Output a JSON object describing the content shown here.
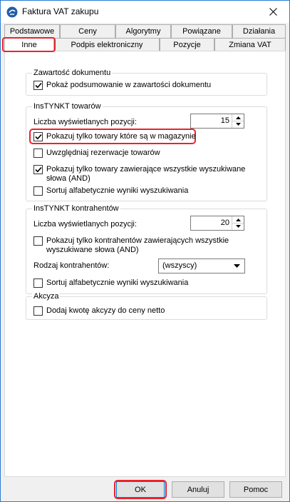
{
  "window": {
    "title": "Faktura VAT zakupu"
  },
  "tabs_row1": [
    "Podstawowe",
    "Ceny",
    "Algorytmy",
    "Powiązane",
    "Działania"
  ],
  "tabs_row2": [
    "Inne",
    "Podpis elektroniczny",
    "Pozycje",
    "Zmiana VAT"
  ],
  "active_tab": "Inne",
  "groups": {
    "zawartosc": {
      "title": "Zawartość dokumentu",
      "show_summary": {
        "label": "Pokaż podsumowanie w zawartości dokumentu",
        "checked": true
      }
    },
    "towary": {
      "title": "InsTYNKT towarów",
      "count_label": "Liczba wyświetlanych pozycji:",
      "count_value": "15",
      "only_in_stock": {
        "label": "Pokazuj tylko towary które są w magazynie",
        "checked": true
      },
      "reservations": {
        "label": "Uwzględniaj rezerwacje towarów",
        "checked": false
      },
      "all_words": {
        "label_line1": "Pokazuj tylko towary zawierające wszystkie wyszukiwane",
        "label_line2": "słowa (AND)",
        "checked": true
      },
      "sort_alpha": {
        "label": "Sortuj alfabetycznie wyniki wyszukiwania",
        "checked": false
      }
    },
    "kontrahenci": {
      "title": "InsTYNKT kontrahentów",
      "count_label": "Liczba wyświetlanych pozycji:",
      "count_value": "20",
      "all_words": {
        "label_line1": "Pokazuj tylko kontrahentów zawierających wszystkie",
        "label_line2": "wyszukiwane słowa (AND)",
        "checked": false
      },
      "type_label": "Rodzaj kontrahentów:",
      "type_value": "(wszyscy)",
      "sort_alpha": {
        "label": "Sortuj alfabetycznie wyniki wyszukiwania",
        "checked": false
      }
    },
    "akcyza": {
      "title": "Akcyza",
      "add_excise": {
        "label": "Dodaj kwotę akcyzy do ceny netto",
        "checked": false
      }
    }
  },
  "buttons": {
    "ok": "OK",
    "cancel": "Anuluj",
    "help": "Pomoc"
  },
  "colors": {
    "highlight": "#e8232c",
    "focus": "#0078d7",
    "titlebar_border": "#2b7cd3"
  }
}
